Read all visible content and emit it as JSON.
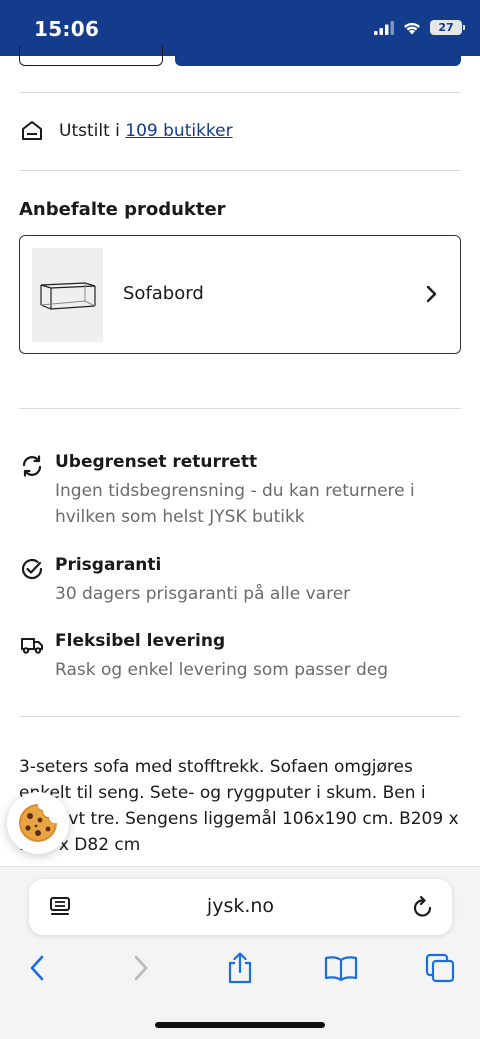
{
  "status_bar": {
    "time": "15:06",
    "battery": "27",
    "bg_color": "#143c8c"
  },
  "availability": {
    "prefix": "Utstilt i",
    "link": "109 butikker",
    "icon": "store-icon"
  },
  "recommended": {
    "title": "Anbefalte produkter",
    "products": [
      {
        "name": "Sofabord",
        "image": "coffee-table-image"
      }
    ]
  },
  "benefits": [
    {
      "icon": "return-arrows-icon",
      "title": "Ubegrenset returrett",
      "text": "Ingen tidsbegrensning - du kan returnere i hvilken som helst JYSK butikk"
    },
    {
      "icon": "check-circle-icon",
      "title": "Prisgaranti",
      "text": "30 dagers prisgaranti på alle varer"
    },
    {
      "icon": "delivery-truck-icon",
      "title": "Fleksibel levering",
      "text": "Rask og enkel levering som passer deg"
    }
  ],
  "description": "3-seters sofa med stofftrekk. Sofaen omgjøres enkelt til seng. Sete- og ryggputer i skum. Ben i massivt tre. Sengens liggemål 106x190 cm. B209 x H82 x D82 cm",
  "browser": {
    "url": "jysk.no",
    "accent_color": "#1a6fe0"
  },
  "colors": {
    "brand_blue": "#143c8c",
    "muted_text": "#6b6b6b"
  }
}
